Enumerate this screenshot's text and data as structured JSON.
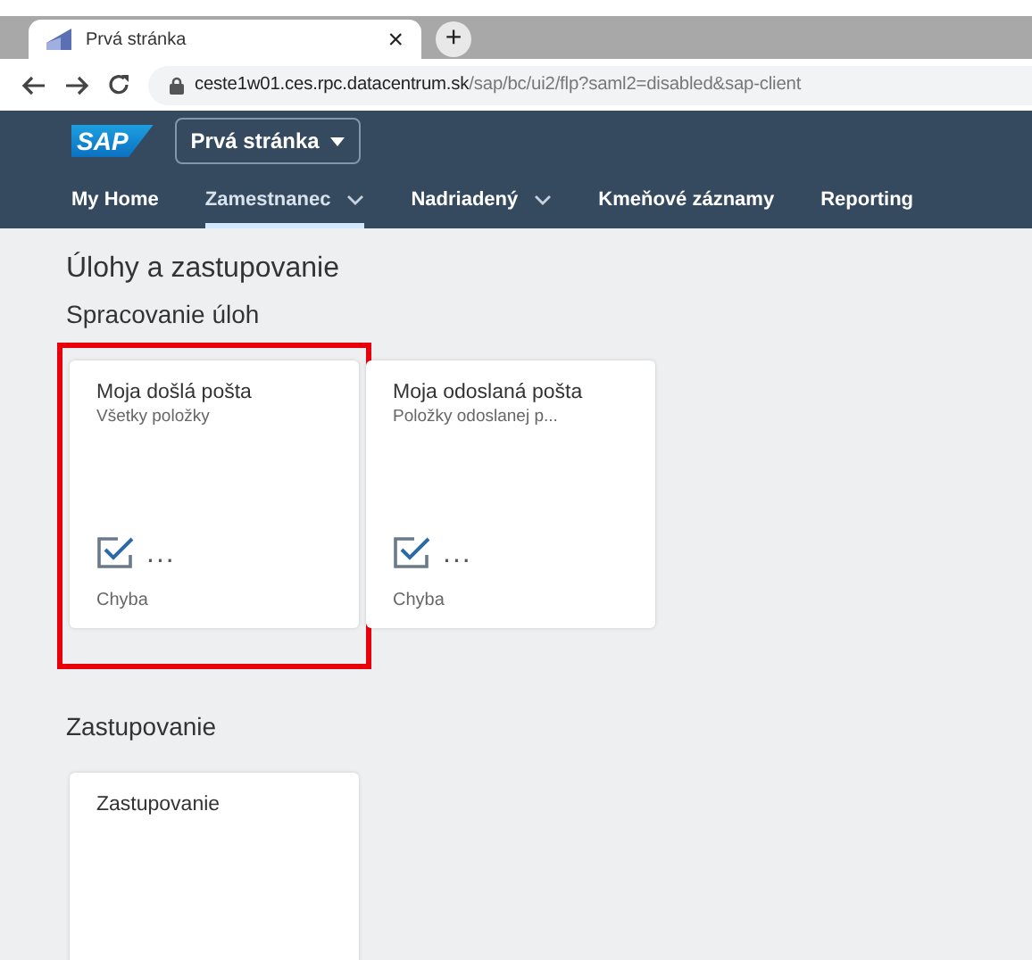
{
  "browser": {
    "tab": {
      "title": "Prvá stránka",
      "close": "×"
    },
    "new_tab": "+",
    "address": {
      "domain": "ceste1w01.ces.rpc.datacentrum.sk",
      "path": "/sap/bc/ui2/flp?saml2=disabled&sap-client"
    }
  },
  "shell": {
    "logo": "SAP",
    "title": "Prvá stránka"
  },
  "nav": [
    {
      "label": "My Home",
      "selected": false,
      "has_menu": false
    },
    {
      "label": "Zamestnanec",
      "selected": true,
      "has_menu": true
    },
    {
      "label": "Nadriadený",
      "selected": false,
      "has_menu": true
    },
    {
      "label": "Kmeňové záznamy",
      "selected": false,
      "has_menu": false
    },
    {
      "label": "Reporting",
      "selected": false,
      "has_menu": false
    }
  ],
  "page_title": "Úlohy a zastupovanie",
  "sections": [
    {
      "title": "Spracovanie úloh",
      "tiles": [
        {
          "title": "Moja došlá pošta",
          "subtitle": "Všetky položky",
          "value": "...",
          "footer": "Chyba",
          "highlighted": true
        },
        {
          "title": "Moja odoslaná pošta",
          "subtitle": "Položky odoslanej p...",
          "value": "...",
          "footer": "Chyba",
          "highlighted": false
        }
      ]
    },
    {
      "title": "Zastupovanie",
      "tiles": [
        {
          "title": "Zastupovanie",
          "highlighted": false
        }
      ]
    }
  ]
}
